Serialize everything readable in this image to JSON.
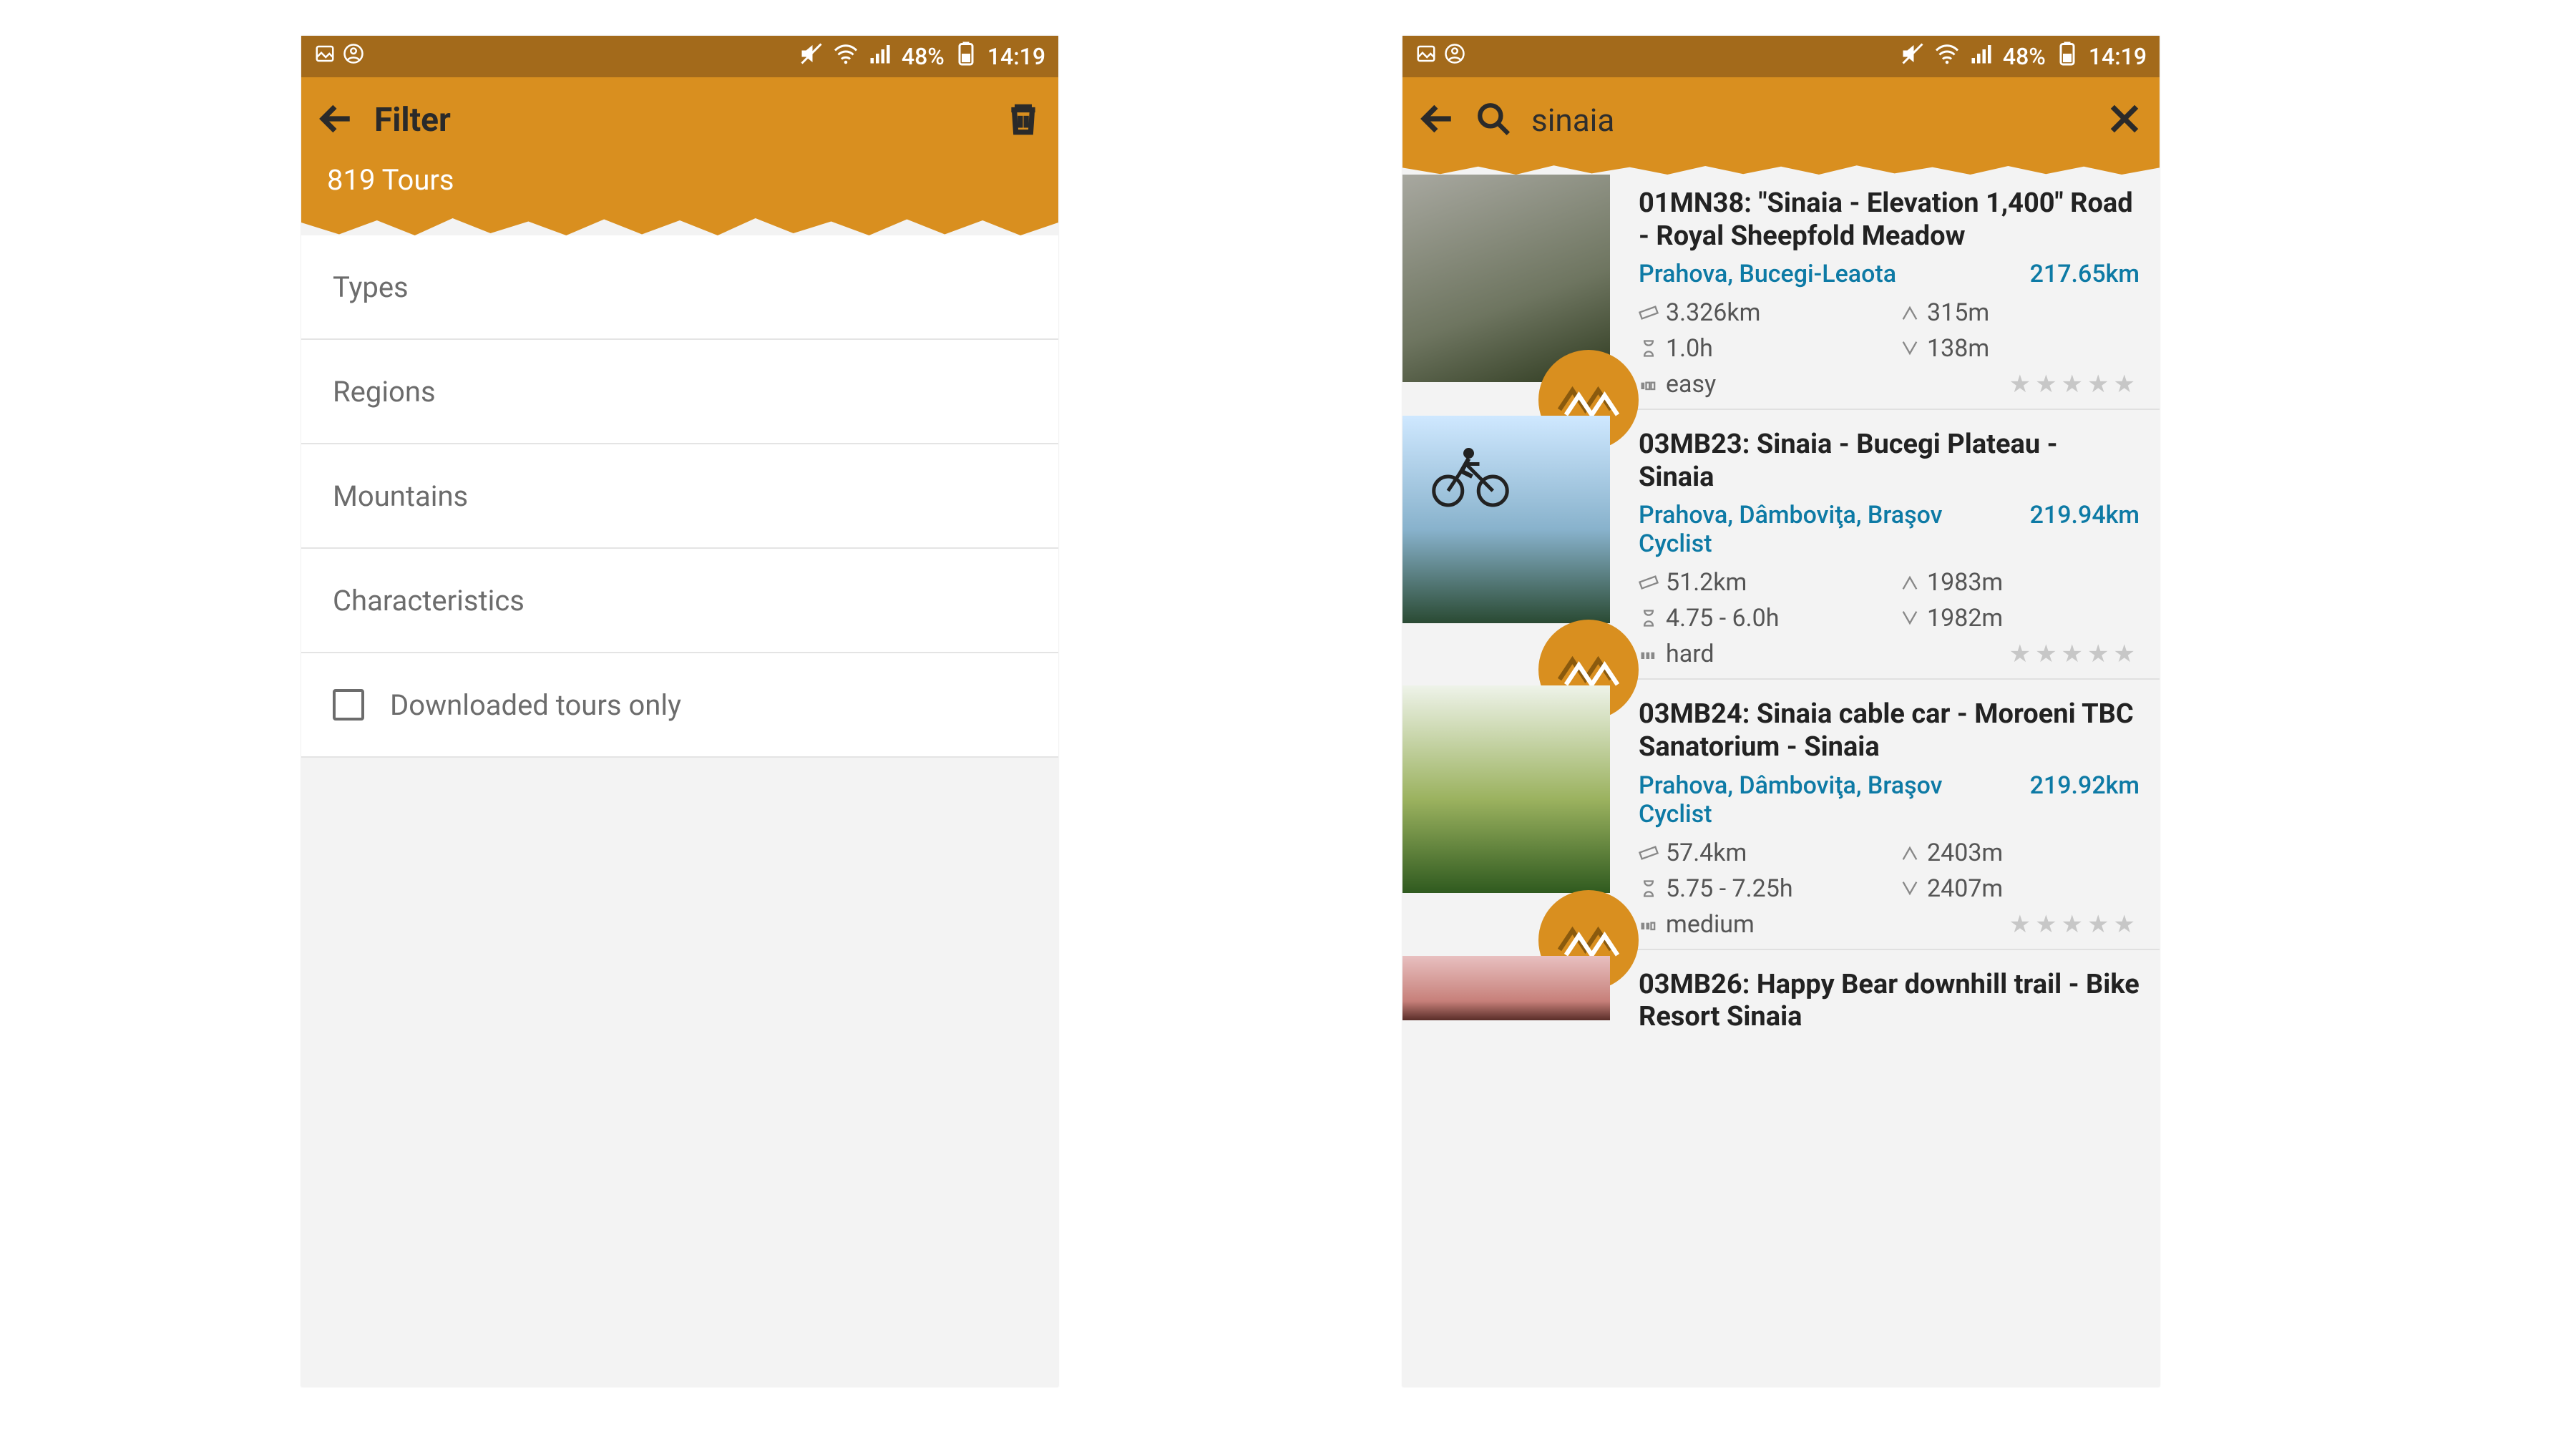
{
  "statusbar": {
    "battery_pct": "48%",
    "time": "14:19"
  },
  "filter_screen": {
    "title": "Filter",
    "subtitle": "819 Tours",
    "items": [
      "Types",
      "Regions",
      "Mountains",
      "Characteristics"
    ],
    "downloaded_label": "Downloaded tours only"
  },
  "search_screen": {
    "query": "sinaia",
    "results": [
      {
        "title": "01MN38: \"Sinaia - Elevation 1,400\" Road - Royal Sheepfold Meadow",
        "region": "Prahova, Bucegi-Leaota",
        "distance": "217.65km",
        "length": "3.326km",
        "ascent": "315m",
        "duration": "1.0h",
        "descent": "138m",
        "difficulty": "easy"
      },
      {
        "title": "03MB23: Sinaia - Bucegi Plateau - Sinaia",
        "region": "Prahova, Dâmboviţa, Braşov Cyclist",
        "distance": "219.94km",
        "length": "51.2km",
        "ascent": "1983m",
        "duration": "4.75 - 6.0h",
        "descent": "1982m",
        "difficulty": "hard"
      },
      {
        "title": "03MB24: Sinaia cable car - Moroeni TBC Sanatorium - Sinaia",
        "region": "Prahova, Dâmboviţa, Braşov Cyclist",
        "distance": "219.92km",
        "length": "57.4km",
        "ascent": "2403m",
        "duration": "5.75 - 7.25h",
        "descent": "2407m",
        "difficulty": "medium"
      },
      {
        "title": "03MB26: Happy Bear downhill trail - Bike Resort Sinaia",
        "region": "",
        "distance": "",
        "length": "",
        "ascent": "",
        "duration": "",
        "descent": "",
        "difficulty": ""
      }
    ]
  }
}
